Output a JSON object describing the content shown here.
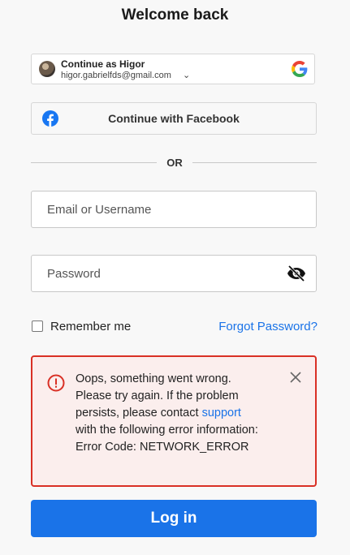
{
  "page": {
    "title": "Welcome back"
  },
  "google": {
    "label": "Continue as Higor",
    "email": "higor.gabrielfds@gmail.com",
    "chevron": "⌄",
    "icon": "google-icon"
  },
  "facebook": {
    "label": "Continue with Facebook",
    "icon": "facebook-icon",
    "color": "#1877f2"
  },
  "divider": {
    "text": "OR"
  },
  "form": {
    "email_placeholder": "Email or Username",
    "email_value": "",
    "password_placeholder": "Password",
    "password_value": "",
    "remember_label": "Remember me",
    "remember_checked": false,
    "forgot_label": "Forgot Password?"
  },
  "error": {
    "text_before_link": "Oops, something went wrong. Please try again. If the problem persists, please contact ",
    "link_text": "support",
    "text_after_link": " with the following error information:",
    "code_line": "Error Code: NETWORK_ERROR",
    "color": "#d93025",
    "background": "#fbeeed"
  },
  "login": {
    "label": "Log in",
    "color": "#1a73e8"
  }
}
